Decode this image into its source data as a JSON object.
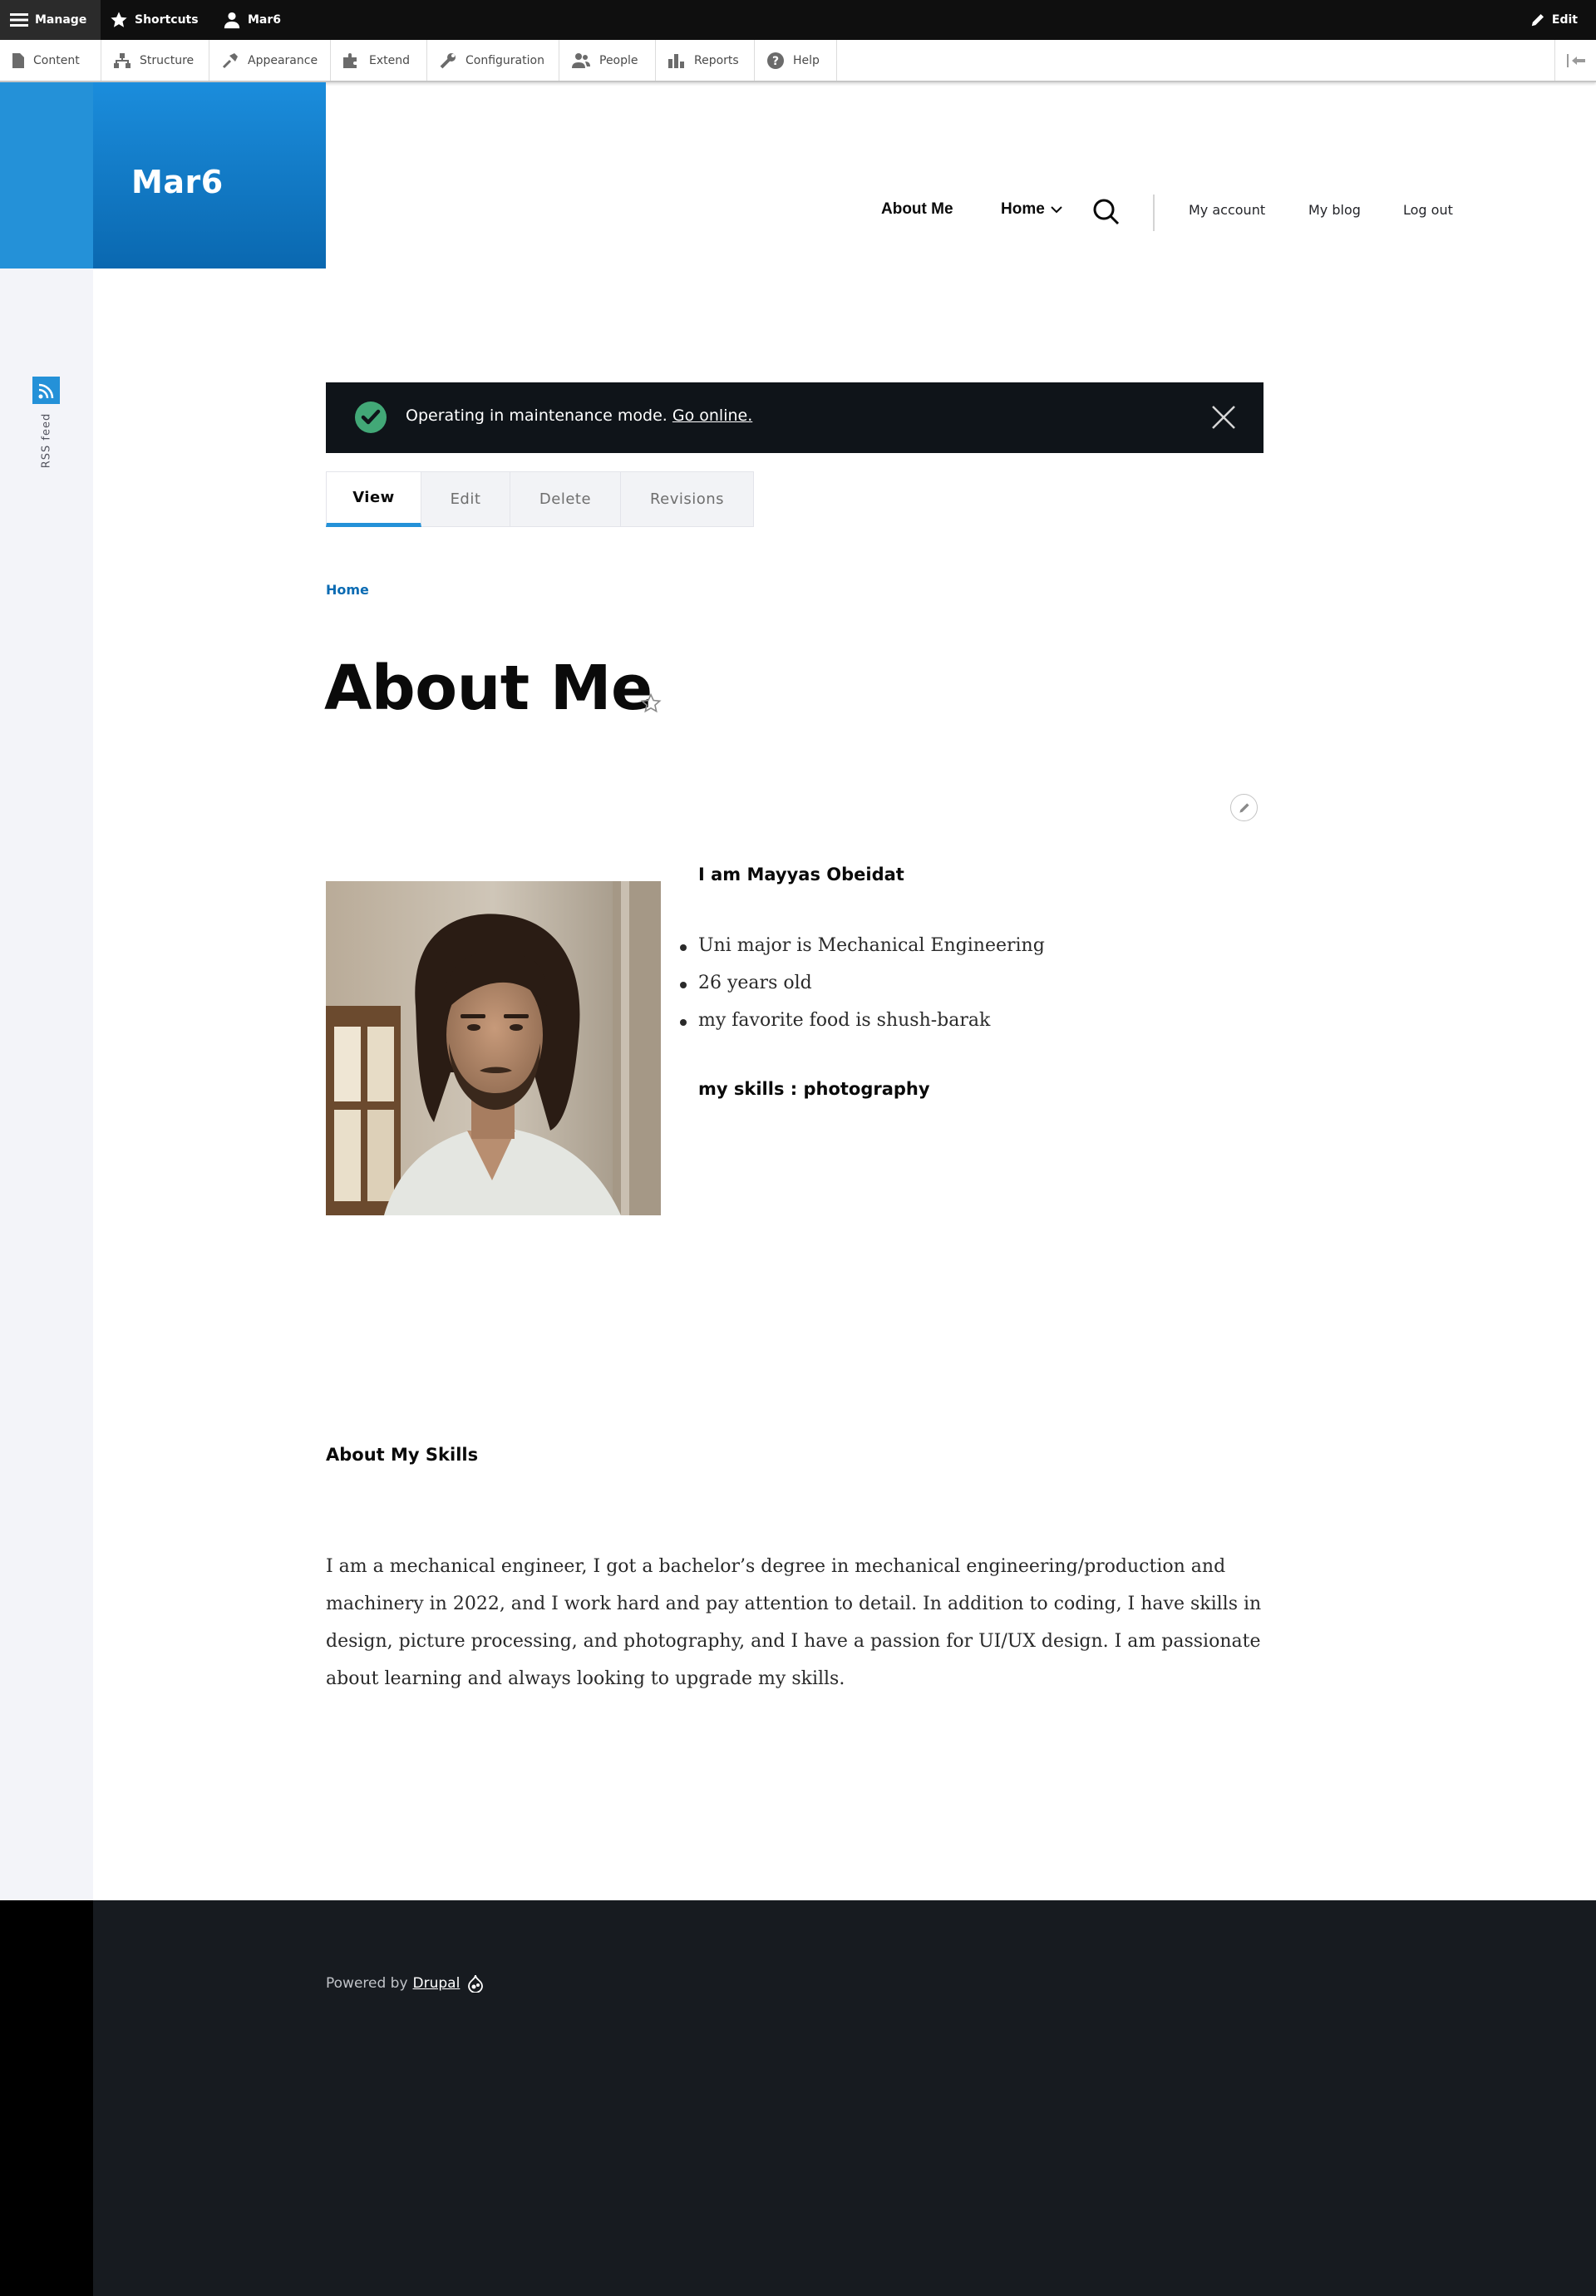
{
  "toolbar": {
    "manage": "Manage",
    "shortcuts": "Shortcuts",
    "user": "Mar6",
    "edit": "Edit"
  },
  "tray": {
    "items": [
      "Content",
      "Structure",
      "Appearance",
      "Extend",
      "Configuration",
      "People",
      "Reports",
      "Help"
    ]
  },
  "site": {
    "name": "Mar6"
  },
  "nav": {
    "about": "About Me",
    "home": "Home",
    "my_account": "My account",
    "my_blog": "My blog",
    "log_out": "Log out"
  },
  "social": {
    "rss": "RSS feed"
  },
  "message": {
    "text": "Operating in maintenance mode.",
    "link": "Go online."
  },
  "tabs": [
    "View",
    "Edit",
    "Delete",
    "Revisions"
  ],
  "breadcrumb": "Home",
  "page": {
    "title": "About Me"
  },
  "content": {
    "intro_heading": "I am Mayyas Obeidat",
    "facts": [
      "Uni major is Mechanical Engineering",
      "26 years old",
      "my favorite food is shush-barak"
    ],
    "skills_heading": "my skills : photography",
    "about_heading": "About My Skills",
    "about_text": "I am a mechanical engineer, I got a bachelor’s degree in mechanical engineering/production and machinery in 2022, and I work hard and pay attention to detail. In addition to coding, I have skills in design, picture processing, and photography, and I have a passion for UI/UX design. I am passionate about learning and always looking to upgrade my skills."
  },
  "footer": {
    "powered_by": "Powered by",
    "drupal": "Drupal"
  },
  "colors": {
    "brand_blue": "#2491d8",
    "toolbar_dark": "#0f0f0f",
    "message_bg": "#0f1419",
    "footer_bg": "#171b20",
    "success_green": "#42a877"
  },
  "icons": [
    "menu-icon",
    "star-icon",
    "user-icon",
    "pencil-icon",
    "content-icon",
    "structure-icon",
    "appearance-icon",
    "extend-icon",
    "configuration-icon",
    "people-icon",
    "reports-icon",
    "help-icon",
    "tray-collapse-icon",
    "chevron-down-icon",
    "search-icon",
    "rss-icon",
    "check-circle-icon",
    "close-icon",
    "drupal-icon"
  ]
}
